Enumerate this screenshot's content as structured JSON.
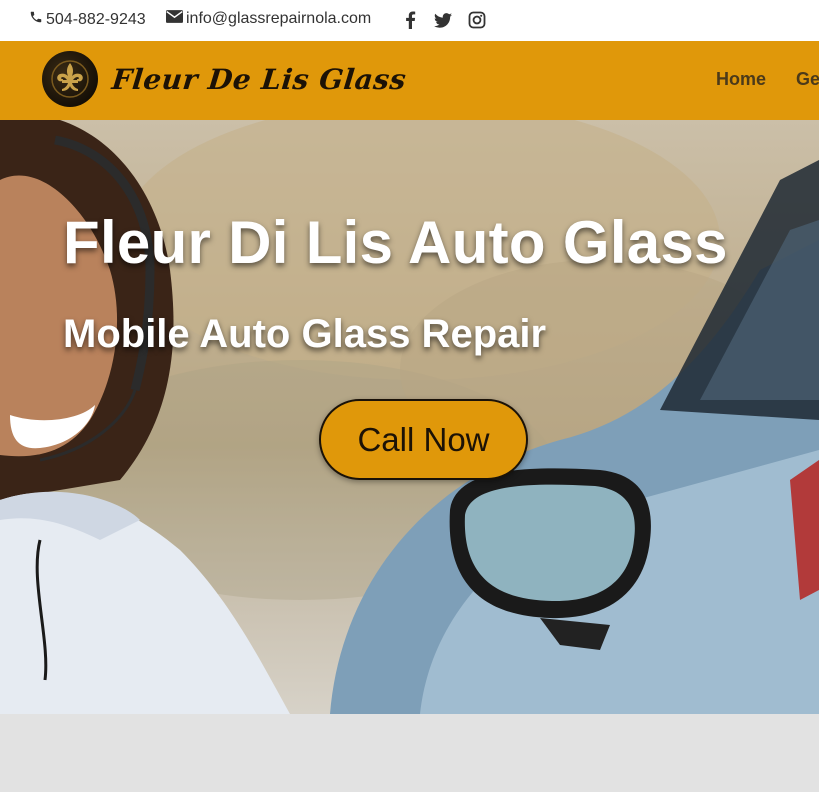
{
  "topbar": {
    "phone": "504-882-9243",
    "email": "info@glassrepairnola.com",
    "social": [
      {
        "name": "facebook-icon"
      },
      {
        "name": "twitter-icon"
      },
      {
        "name": "instagram-icon"
      }
    ]
  },
  "header": {
    "logo_text": "Fleur De Lis Glass",
    "nav": [
      {
        "label": "Home"
      },
      {
        "label": "Ge"
      }
    ]
  },
  "hero": {
    "title": "Fleur Di Lis Auto Glass",
    "subtitle": "Mobile Auto Glass Repair",
    "cta_label": "Call Now"
  },
  "colors": {
    "accent": "#e0980a",
    "topbar_bg": "#ffffff",
    "page_bg": "#e2e2e2",
    "text_dark": "#1c1206"
  }
}
